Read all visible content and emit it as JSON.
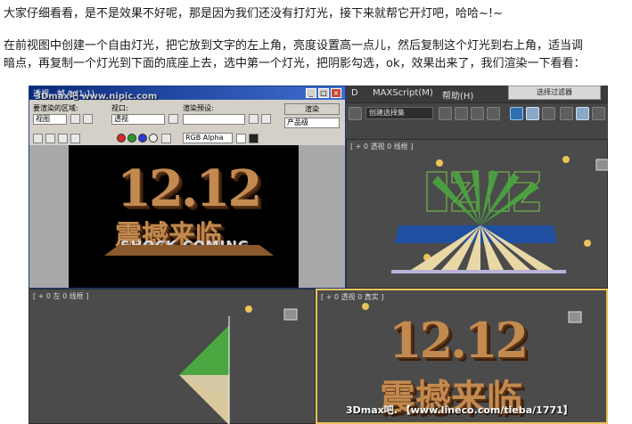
{
  "article": {
    "line1": "大家仔细看看，是不是效果不好呢，那是因为我们还没有打灯光，接下来就帮它开灯吧，哈哈~!~",
    "line2": "在前视图中创建一个自由灯光，把它放到文字的左上角，亮度设置高一点儿，然后复制这个灯光到右上角，适当调",
    "line3": "暗点，再复制一个灯光到下面的底座上去，选中第一个灯光，把阴影勾选，ok，效果出来了，我们渲染一下看看："
  },
  "render_window": {
    "title": "透视，帧 0 (1:1)",
    "area_label": "要渲染的区域:",
    "area_value": "视图",
    "viewport_label": "视口:",
    "viewport_value": "透视",
    "preset_label": "渲染预设:",
    "render_button": "渲染",
    "product_value": "产品级",
    "channel_value": "RGB Alpha",
    "minimize": "_",
    "maximize": "□",
    "close": "×"
  },
  "max": {
    "menus": [
      "D",
      "MAXScript(M)",
      "帮助(H)"
    ],
    "selection_set": "创建选择集",
    "top_button": "选择过滤器"
  },
  "viewports": {
    "top_right_label": "[ + 0 透视 0 线框 ]",
    "bottom_left_label": "[ + 0 左 0 线框 ]",
    "bottom_right_label": "[ + 0 透视 0 真实 ]"
  },
  "render_text": {
    "number": "12.12",
    "chinese": "震撼来临",
    "english": "SHOCK COMING"
  },
  "watermarks": {
    "title_overlay": "3Dmax吧  www.nipic.com",
    "bottom": "3Dmax吧. 【www.lineco.com/tieba/1771】"
  },
  "colors": {
    "title_bar_start": "#0a2a7a",
    "title_bar_end": "#3f6ed0",
    "viewport_bg": "#4b4b4b",
    "active_viewport_border": "#e8c45a",
    "render_gold": "#c38a50"
  }
}
